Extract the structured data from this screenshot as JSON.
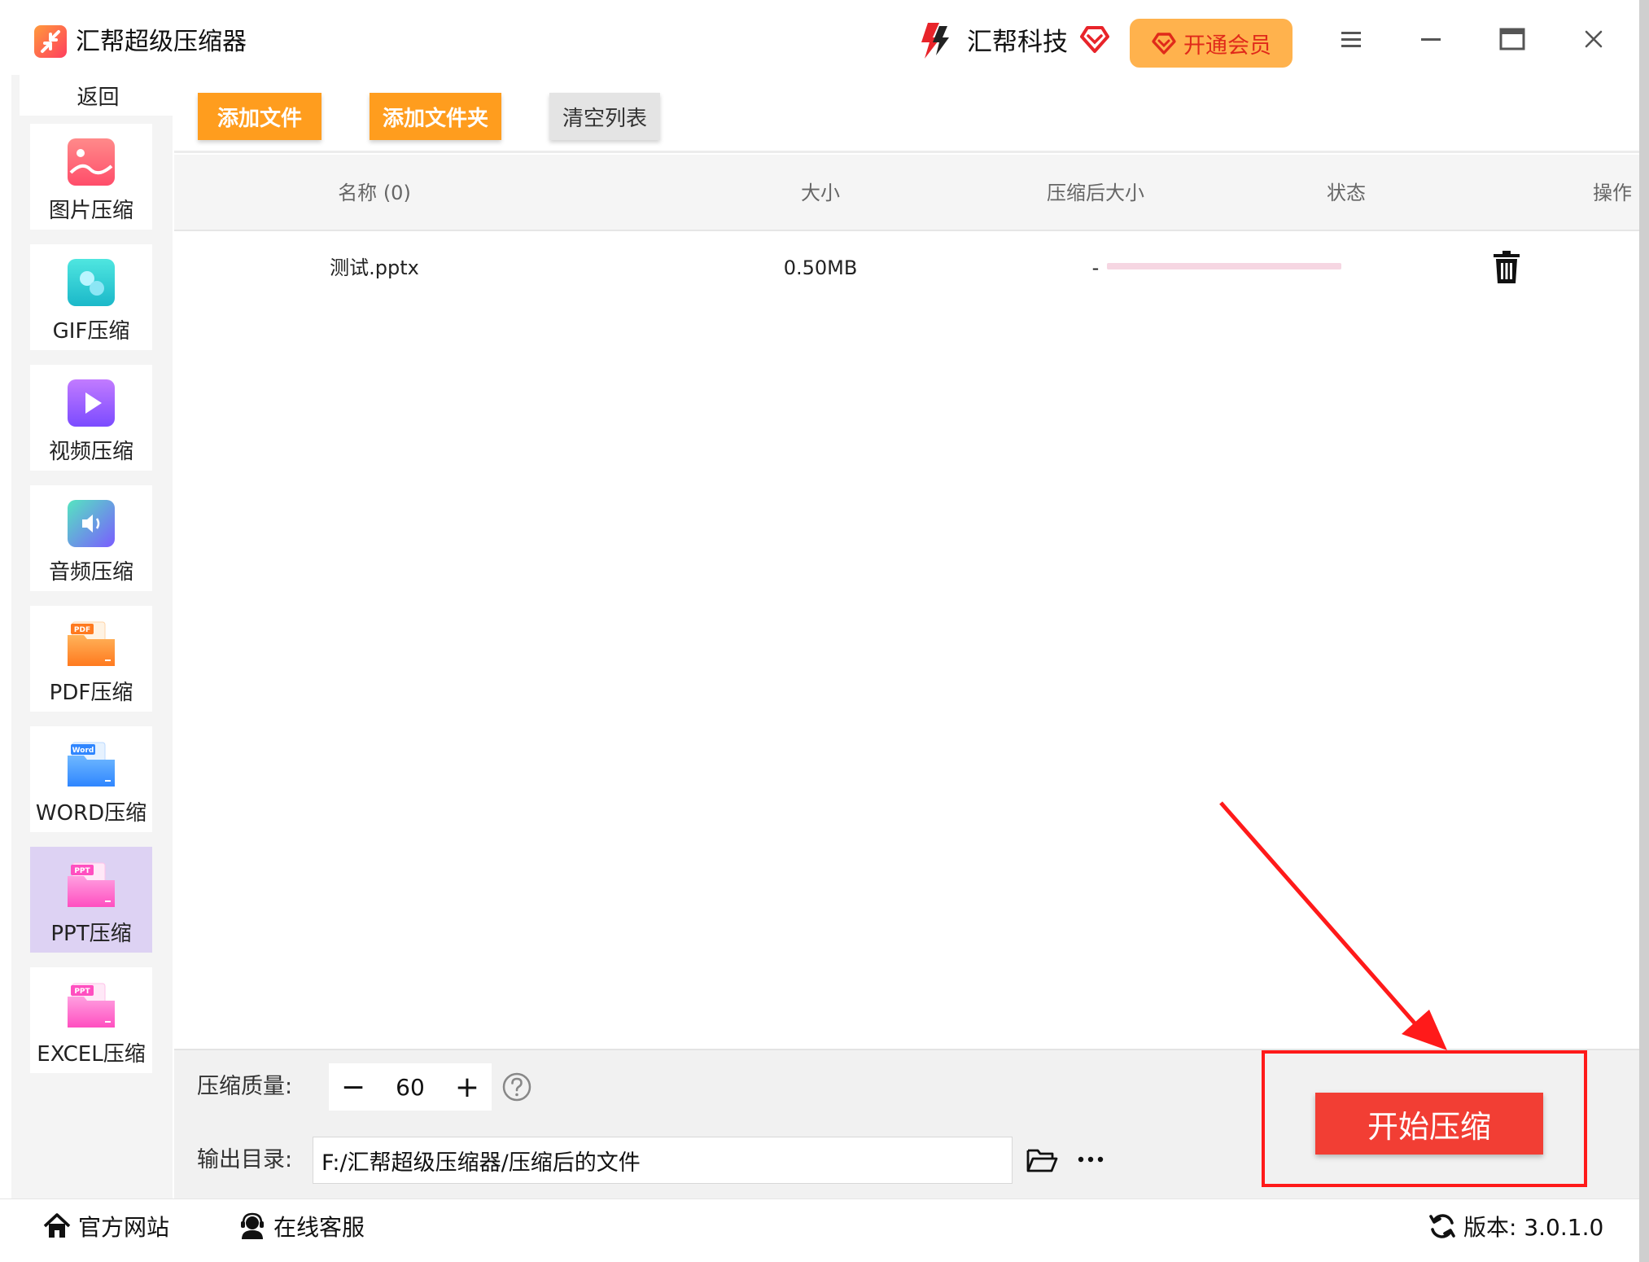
{
  "app": {
    "title": "汇帮超级压缩器",
    "brand": "汇帮科技",
    "vip_label": "开通会员"
  },
  "sidebar": {
    "back_label": "返回",
    "items": [
      {
        "label": "图片压缩",
        "icon": "image-compress-icon"
      },
      {
        "label": "GIF压缩",
        "icon": "gif-compress-icon"
      },
      {
        "label": "视频压缩",
        "icon": "video-compress-icon"
      },
      {
        "label": "音频压缩",
        "icon": "audio-compress-icon"
      },
      {
        "label": "PDF压缩",
        "icon": "pdf-compress-icon",
        "badge": "PDF"
      },
      {
        "label": "WORD压缩",
        "icon": "word-compress-icon",
        "badge": "Word"
      },
      {
        "label": "PPT压缩",
        "icon": "ppt-compress-icon",
        "badge": "PPT",
        "active": true
      },
      {
        "label": "EXCEL压缩",
        "icon": "excel-compress-icon",
        "badge": "PPT"
      }
    ]
  },
  "toolbar": {
    "add_file": "添加文件",
    "add_folder": "添加文件夹",
    "clear_list": "清空列表"
  },
  "table": {
    "columns": [
      "名称 (0)",
      "大小",
      "压缩后大小",
      "状态",
      "操作"
    ],
    "rows": [
      {
        "name": "测试.pptx",
        "size": "0.50MB",
        "compressed_size": "-",
        "progress": 0
      }
    ]
  },
  "settings": {
    "quality_label": "压缩质量:",
    "quality_value": "60",
    "minus": "−",
    "plus": "+",
    "output_label": "输出目录:",
    "output_path": "F:/汇帮超级压缩器/压缩后的文件",
    "start_label": "开始压缩"
  },
  "statusbar": {
    "website": "官方网站",
    "support": "在线客服",
    "version": "版本:  3.0.1.0"
  },
  "colors": {
    "accent_orange": "#ff9d1e",
    "start_red": "#f23e34",
    "highlight_red": "#ff1a1a",
    "active_item": "#ddd2f3",
    "vip_bg": "#ffb24d"
  }
}
